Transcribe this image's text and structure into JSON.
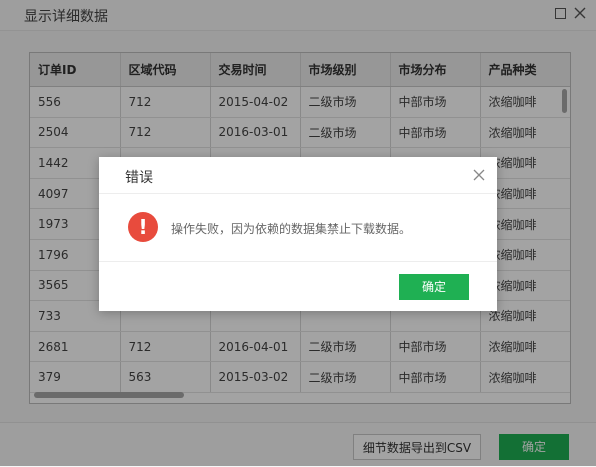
{
  "window": {
    "title": "显示详细数据"
  },
  "table": {
    "columns": [
      "订单ID",
      "区域代码",
      "交易时间",
      "市场级别",
      "市场分布",
      "产品种类"
    ],
    "rows": [
      [
        "556",
        "712",
        "2015-04-02",
        "二级市场",
        "中部市场",
        "浓缩咖啡"
      ],
      [
        "2504",
        "712",
        "2016-03-01",
        "二级市场",
        "中部市场",
        "浓缩咖啡"
      ],
      [
        "1442",
        "",
        "",
        "",
        "",
        "浓缩咖啡"
      ],
      [
        "4097",
        "",
        "",
        "",
        "",
        "浓缩咖啡"
      ],
      [
        "1973",
        "",
        "",
        "",
        "",
        "浓缩咖啡"
      ],
      [
        "1796",
        "",
        "",
        "",
        "",
        "浓缩咖啡"
      ],
      [
        "3565",
        "",
        "",
        "",
        "",
        "浓缩咖啡"
      ],
      [
        "733",
        "",
        "",
        "",
        "",
        "浓缩咖啡"
      ],
      [
        "2681",
        "712",
        "2016-04-01",
        "二级市场",
        "中部市场",
        "浓缩咖啡"
      ],
      [
        "379",
        "563",
        "2015-03-02",
        "二级市场",
        "中部市场",
        "浓缩咖啡"
      ]
    ]
  },
  "footer": {
    "export_label": "细节数据导出到CSV",
    "ok_label": "确定"
  },
  "dialog": {
    "title": "错误",
    "icon": "error-icon",
    "icon_glyph": "!",
    "message": "操作失败，因为依赖的数据集禁止下载数据。",
    "ok_label": "确定"
  },
  "colors": {
    "primary": "#1fb053",
    "error": "#e84b3d",
    "overlay": "#000000"
  }
}
